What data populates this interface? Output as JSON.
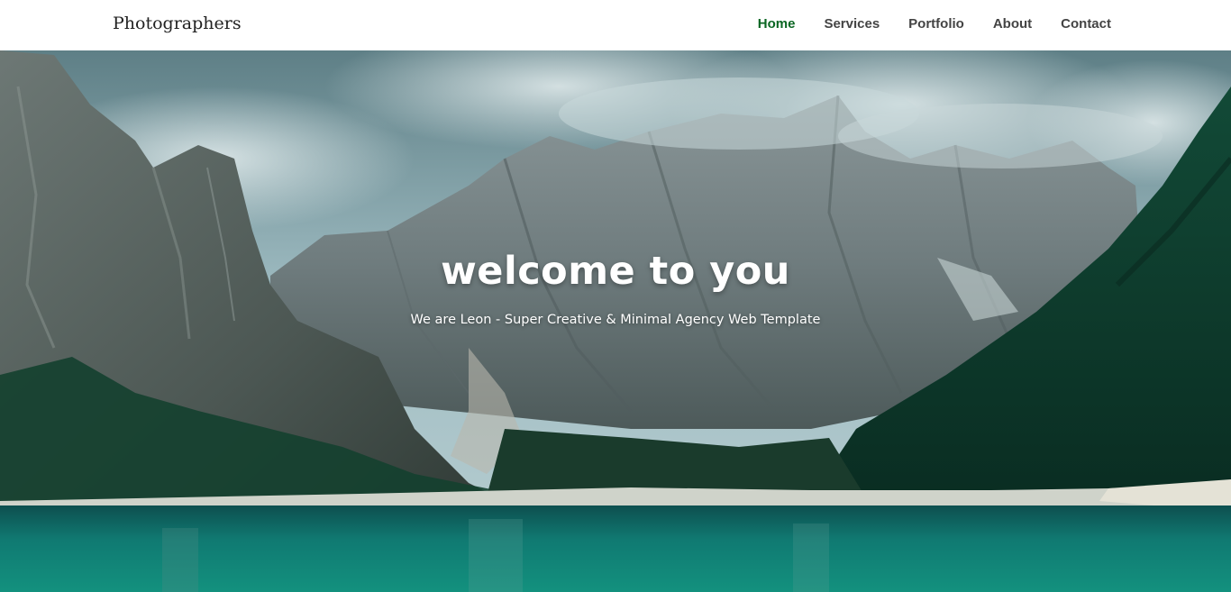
{
  "header": {
    "brand": "Photographers"
  },
  "nav": {
    "items": [
      {
        "label": "Home",
        "active": true
      },
      {
        "label": "Services",
        "active": false
      },
      {
        "label": "Portfolio",
        "active": false
      },
      {
        "label": "About",
        "active": false
      },
      {
        "label": "Contact",
        "active": false
      }
    ]
  },
  "hero": {
    "title": "welcome to you",
    "subtitle": "We are Leon - Super Creative & Minimal Agency Web Template"
  },
  "colors": {
    "nav_active": "#0b6623",
    "nav_text": "#444444",
    "lake": "#0f6e68",
    "forest": "#0c3a2a",
    "sky": "#8fb1b8"
  }
}
